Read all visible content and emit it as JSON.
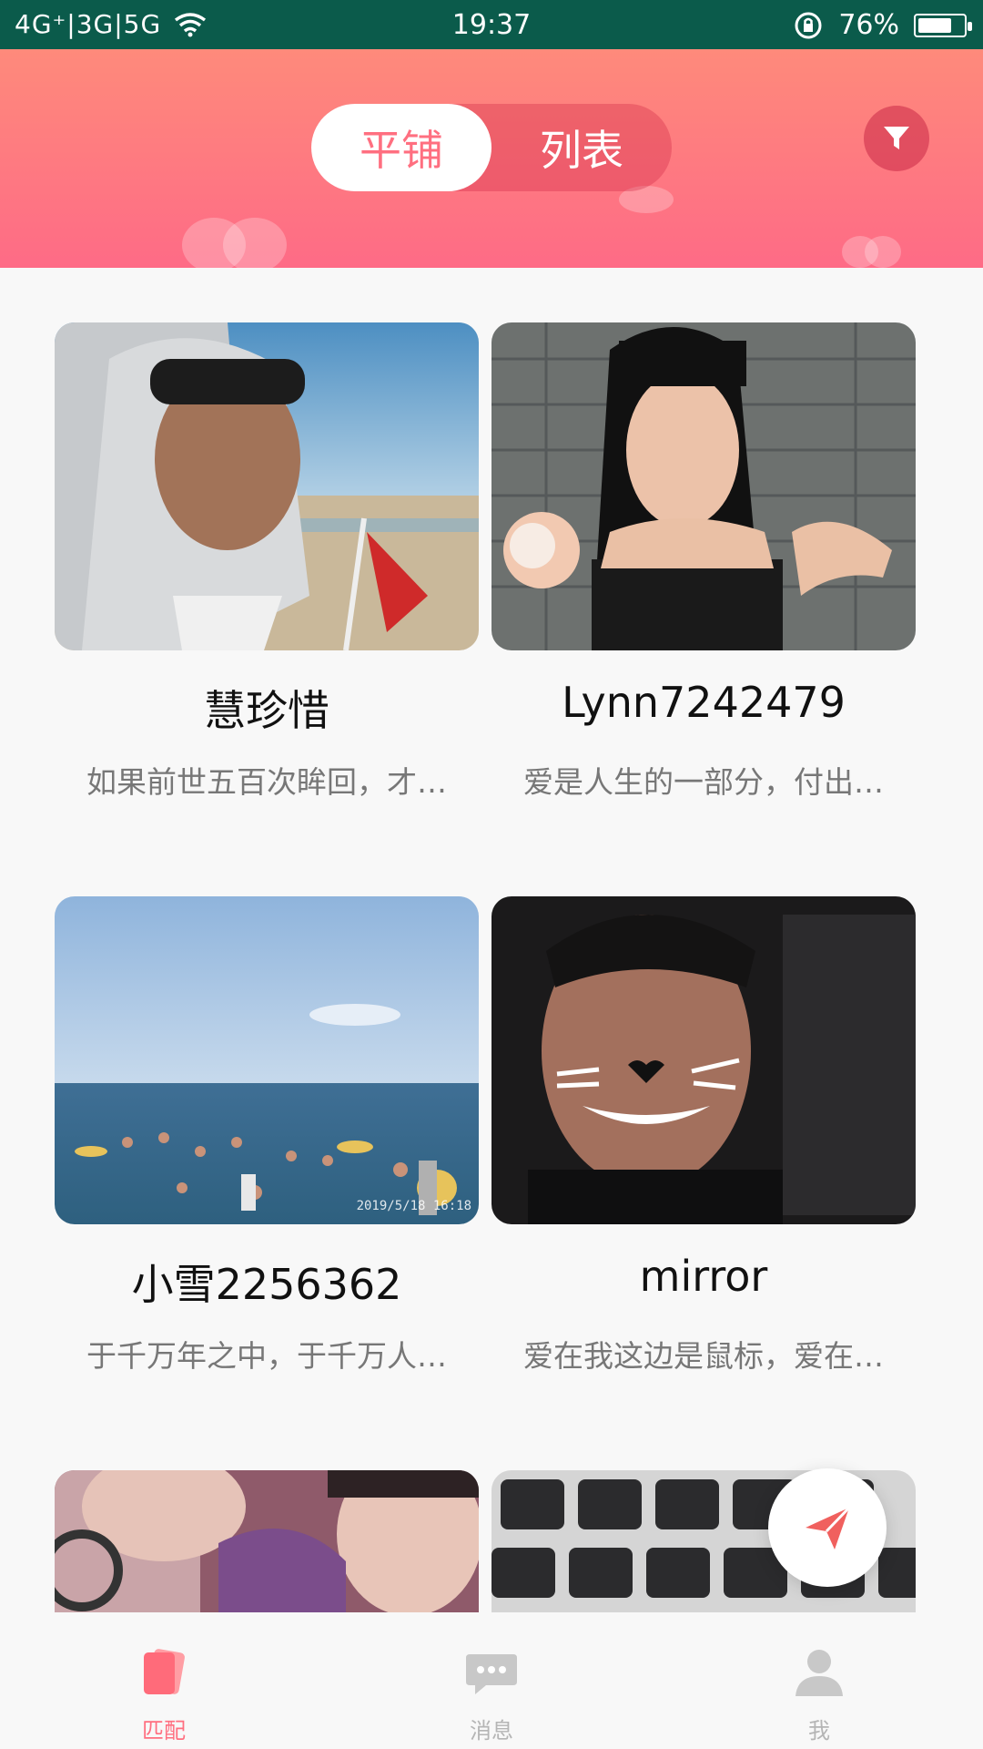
{
  "status_bar": {
    "network": "4G⁺|3G|5G",
    "time": "19:37",
    "battery": "76%",
    "battery_level": 0.76
  },
  "header": {
    "tabs": [
      {
        "label": "平铺",
        "active": true
      },
      {
        "label": "列表",
        "active": false
      }
    ],
    "filter_icon": "filter-icon"
  },
  "cards": [
    {
      "name": "慧珍惜",
      "bio": "如果前世五百次眸回，才…"
    },
    {
      "name": "Lynn7242479",
      "bio": "爱是人生的一部分，付出…"
    },
    {
      "name": "小雪2256362",
      "bio": "于千万年之中，于千万人…",
      "photo_date": "2019/5/18  16:18"
    },
    {
      "name": "mirror",
      "bio": "爱在我这边是鼠标，爱在…"
    }
  ],
  "fab_icon": "send-icon",
  "tab_bar": {
    "items": [
      {
        "label": "匹配",
        "icon": "cards-icon",
        "active": true
      },
      {
        "label": "消息",
        "icon": "chat-bubble-icon",
        "active": false
      },
      {
        "label": "我",
        "icon": "person-icon",
        "active": false
      }
    ]
  },
  "colors": {
    "accent": "#ff6f80",
    "header_top": "#fe8a7b",
    "header_bottom": "#fe6b86",
    "status_bar": "#0b5b4b",
    "inactive_tab": "#c8c8c8"
  }
}
